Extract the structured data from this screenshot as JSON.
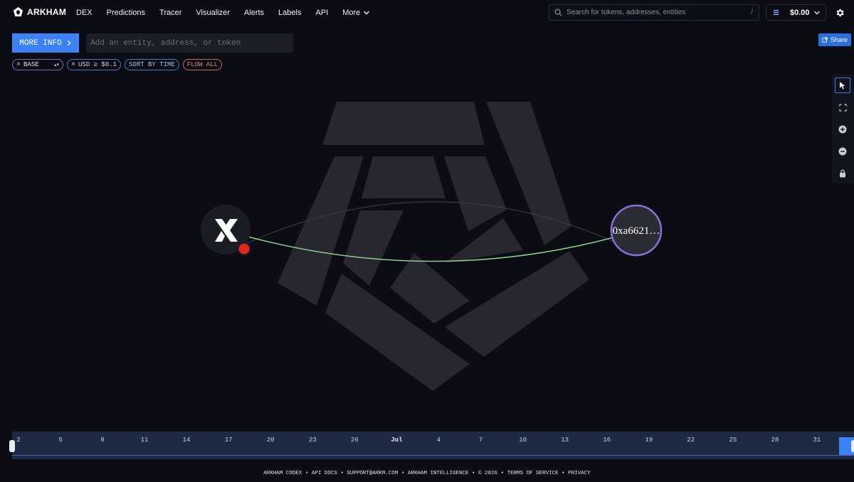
{
  "brand": {
    "name": "ARKHAM"
  },
  "nav": {
    "items": [
      {
        "label": "DEX"
      },
      {
        "label": "Predictions"
      },
      {
        "label": "Tracer"
      },
      {
        "label": "Visualizer"
      },
      {
        "label": "Alerts"
      },
      {
        "label": "Labels"
      },
      {
        "label": "API"
      },
      {
        "label": "More"
      }
    ]
  },
  "search": {
    "placeholder": "Search for tokens, addresses, entities",
    "shortcut": "/"
  },
  "wallet": {
    "balance": "$0.00"
  },
  "controls": {
    "more_info_label": "MORE INFO",
    "entity_placeholder": "Add an entity, address, or token",
    "share_label": "Share"
  },
  "filters": {
    "network": "BASE",
    "usd": "USD ≥ $0.1",
    "sort": "SORT BY TIME",
    "flow": "FLOW ALL"
  },
  "graph": {
    "nodes": [
      {
        "id": "x-entity",
        "glyph": "X",
        "icon": "x-logo",
        "has_alert": true
      },
      {
        "id": "address",
        "label": "0xa6621…",
        "ring_color": "#8c6fd8"
      }
    ],
    "edges": [
      {
        "from": "x-entity",
        "to": "address",
        "color": "#8fd08a"
      }
    ]
  },
  "timeline": {
    "ticks": [
      "2",
      "5",
      "8",
      "11",
      "14",
      "17",
      "20",
      "23",
      "26",
      "Jul",
      "4",
      "7",
      "10",
      "13",
      "16",
      "19",
      "22",
      "25",
      "28",
      "31"
    ],
    "bold_tick": "Jul"
  },
  "footer": {
    "items": [
      "ARKHAM CODEX",
      "API DOCS",
      "SUPPORT@ARKM.COM",
      "ARKHAM INTELLIGENCE",
      "© 2026",
      "TERMS OF SERVICE",
      "PRIVACY"
    ],
    "separator": "•"
  },
  "colors": {
    "background": "#0b0c14",
    "accent": "#3b82f6",
    "node_ring": "#8c6fd8",
    "edge": "#8fd08a",
    "alert": "#e0261c"
  }
}
